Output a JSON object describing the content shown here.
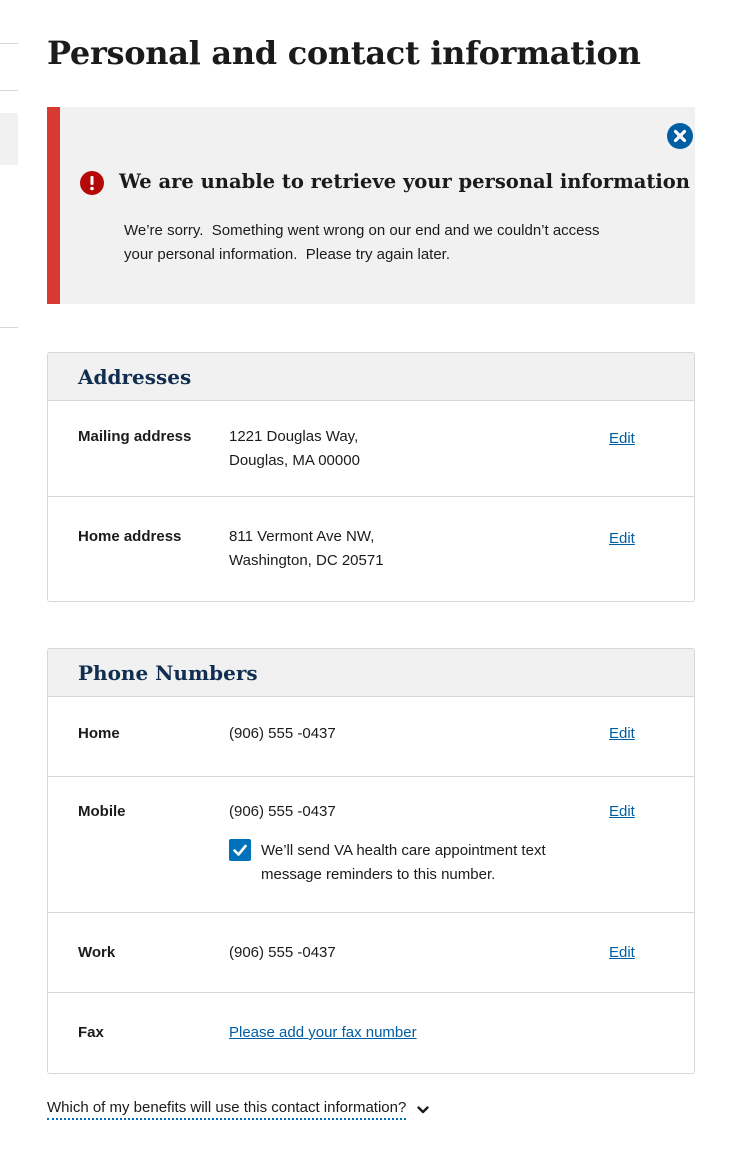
{
  "page": {
    "title": "Personal and contact information"
  },
  "alert": {
    "heading": "We are unable to retrieve your personal information",
    "body": "We’re sorry.  Something went wrong on our end and we couldn’t access your personal information.  Please try again later.",
    "status_color": "#d83933"
  },
  "addresses": {
    "title": "Addresses",
    "rows": [
      {
        "label": "Mailing address",
        "line1": "1221 Douglas Way,",
        "line2": "Douglas, MA 00000",
        "action": "Edit"
      },
      {
        "label": "Home address",
        "line1": "811 Vermont Ave NW,",
        "line2": "Washington, DC 20571",
        "action": "Edit"
      }
    ]
  },
  "phones": {
    "title": "Phone Numbers",
    "home": {
      "label": "Home",
      "value": "(906) 555 -0437",
      "action": "Edit"
    },
    "mobile": {
      "label": "Mobile",
      "value": "(906) 555 -0437",
      "action": "Edit",
      "reminder_checked": true,
      "reminder_text": "We’ll send VA health care appointment text message reminders to this number."
    },
    "work": {
      "label": "Work",
      "value": "(906) 555 -0437",
      "action": "Edit"
    },
    "fax": {
      "label": "Fax",
      "link": "Please add your fax number"
    }
  },
  "footer": {
    "expander": "Which of my benefits will use this contact information?"
  },
  "icons": {
    "close": "close-circle-icon",
    "error": "exclamation-circle-icon",
    "check": "checkmark-icon",
    "chevron": "chevron-down-icon"
  }
}
